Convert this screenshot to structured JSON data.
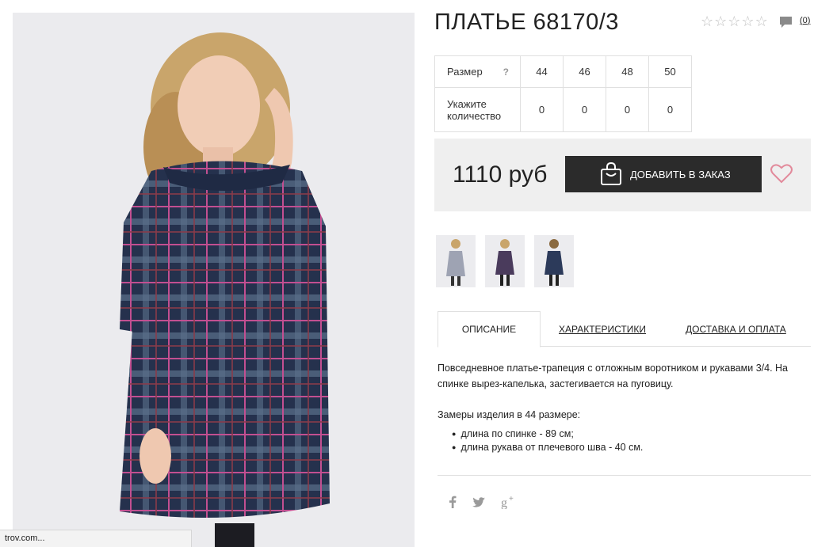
{
  "product": {
    "title": "ПЛАТЬЕ 68170/3",
    "rating": {
      "max": 5,
      "value": 0
    },
    "review_count": "0"
  },
  "size_table": {
    "size_header": "Размер",
    "help": "?",
    "sizes": [
      "44",
      "46",
      "48",
      "50"
    ],
    "qty_label": "Укажите количество",
    "quantities": [
      "0",
      "0",
      "0",
      "0"
    ]
  },
  "price": {
    "value": "1110 руб",
    "order_button": "ДОБАВИТЬ В ЗАКАЗ"
  },
  "tabs": {
    "description": "ОПИСАНИЕ",
    "characteristics": "ХАРАКТЕРИСТИКИ",
    "delivery": "ДОСТАВКА И ОПЛАТА"
  },
  "description": {
    "text": "Повседневное платье-трапеция с отложным воротником и рукавами 3/4. На спинке вырез-капелька, застегивается на пуговицу.",
    "measures_title": "Замеры изделия в 44 размере:",
    "measures": [
      "длина по спинке - 89 см;",
      "длина рукава от плечевого шва - 40 см."
    ]
  },
  "status_bar": "trov.com...",
  "icons": {
    "rating": "star-outline-icon",
    "comments": "speech-bubble-icon",
    "order": "shopping-bag-icon",
    "favorite": "heart-outline-icon",
    "social": [
      "facebook-icon",
      "twitter-icon",
      "google-plus-icon"
    ]
  },
  "colors": {
    "button_bg": "#2b2b2b",
    "heart": "#e28a9b",
    "price_bg": "#efefef"
  }
}
